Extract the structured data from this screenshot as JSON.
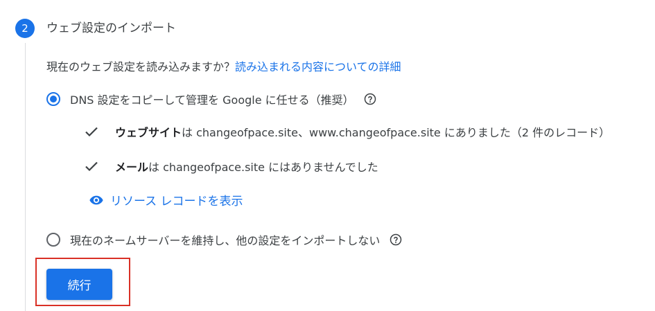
{
  "step": {
    "number": "2",
    "title": "ウェブ設定のインポート"
  },
  "question": {
    "text": "現在のウェブ設定を読み込みますか？",
    "link_label": "読み込まれる内容についての詳細"
  },
  "options": {
    "copy_dns": {
      "label": "DNS 設定をコピーして管理を Google に任せる（推奨）",
      "selected": true,
      "help_icon": "help-circle-icon"
    },
    "keep_nameservers": {
      "label": "現在のネームサーバーを維持し、他の設定をインポートしない",
      "selected": false,
      "help_icon": "help-circle-icon"
    }
  },
  "checks": [
    {
      "bold": "ウェブサイト",
      "text": "は changeofpace.site、www.changeofpace.site にありました（2 件のレコード）",
      "icon": "check-icon"
    },
    {
      "bold": "メール",
      "text": "は changeofpace.site にはありませんでした",
      "icon": "check-icon"
    }
  ],
  "resource_link": {
    "label": "リソース レコードを表示",
    "icon": "eye-icon"
  },
  "continue_button": {
    "label": "続行"
  },
  "colors": {
    "accent": "#1a73e8",
    "highlight": "#d93025",
    "text": "#3c4043"
  }
}
